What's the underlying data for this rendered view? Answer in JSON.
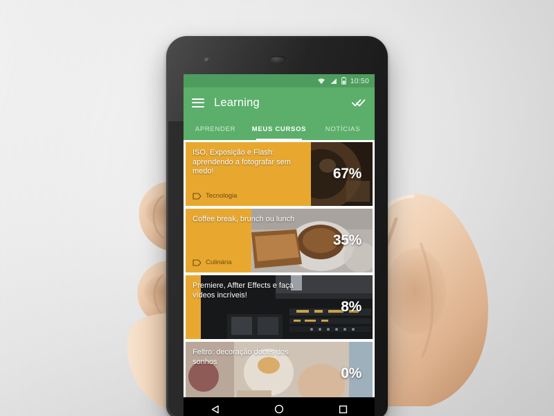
{
  "device": {
    "name": "android-phone",
    "front_camera": "front-camera",
    "earpiece": "earpiece-speaker"
  },
  "statusbar": {
    "wifi_icon": "wifi-icon",
    "signal_icon": "cellular-signal-icon",
    "battery_icon": "battery-icon",
    "time": "10:50"
  },
  "toolbar": {
    "menu_icon": "hamburger-menu-icon",
    "title": "Learning",
    "done_all_icon": "done-all-icon"
  },
  "tabs": [
    {
      "label": "APRENDER",
      "active": false
    },
    {
      "label": "MEUS CURSOS",
      "active": true
    },
    {
      "label": "NOTÍCIAS",
      "active": false
    }
  ],
  "courses": [
    {
      "title": "ISO, Exposição e Flash: aprendendo a fotografar sem medo!",
      "tag": "Tecnologia",
      "tag_icon": "label-tag-icon",
      "percent_label": "67%",
      "percent": 67,
      "photo": "camera-lens-photo",
      "tag_on_dark": false
    },
    {
      "title": "Coffee break, brunch ou lunch",
      "tag": "Culinária",
      "tag_icon": "label-tag-icon",
      "percent_label": "35%",
      "percent": 35,
      "photo": "coffee-brunch-photo",
      "tag_on_dark": false
    },
    {
      "title": "Premiere, Affter Effects e faça vídeos incríveis!",
      "tag": "",
      "tag_icon": "",
      "percent_label": "8%",
      "percent": 8,
      "photo": "video-editing-desk-photo",
      "tag_on_dark": true
    },
    {
      "title": "Feltro: decoração doces dos sonhos",
      "tag": "",
      "tag_icon": "",
      "percent_label": "0%",
      "percent": 0,
      "photo": "felt-craft-photo",
      "tag_on_dark": true
    }
  ],
  "navbar": {
    "back_icon": "back-triangle-icon",
    "home_icon": "home-circle-icon",
    "recents_icon": "recents-square-icon"
  },
  "colors": {
    "accent_green": "#5caf6b",
    "statusbar_green": "#4e9c5e",
    "progress_orange": "#e8a830",
    "tag_text": "#6d4a14",
    "card_bg": "#2a2520"
  }
}
